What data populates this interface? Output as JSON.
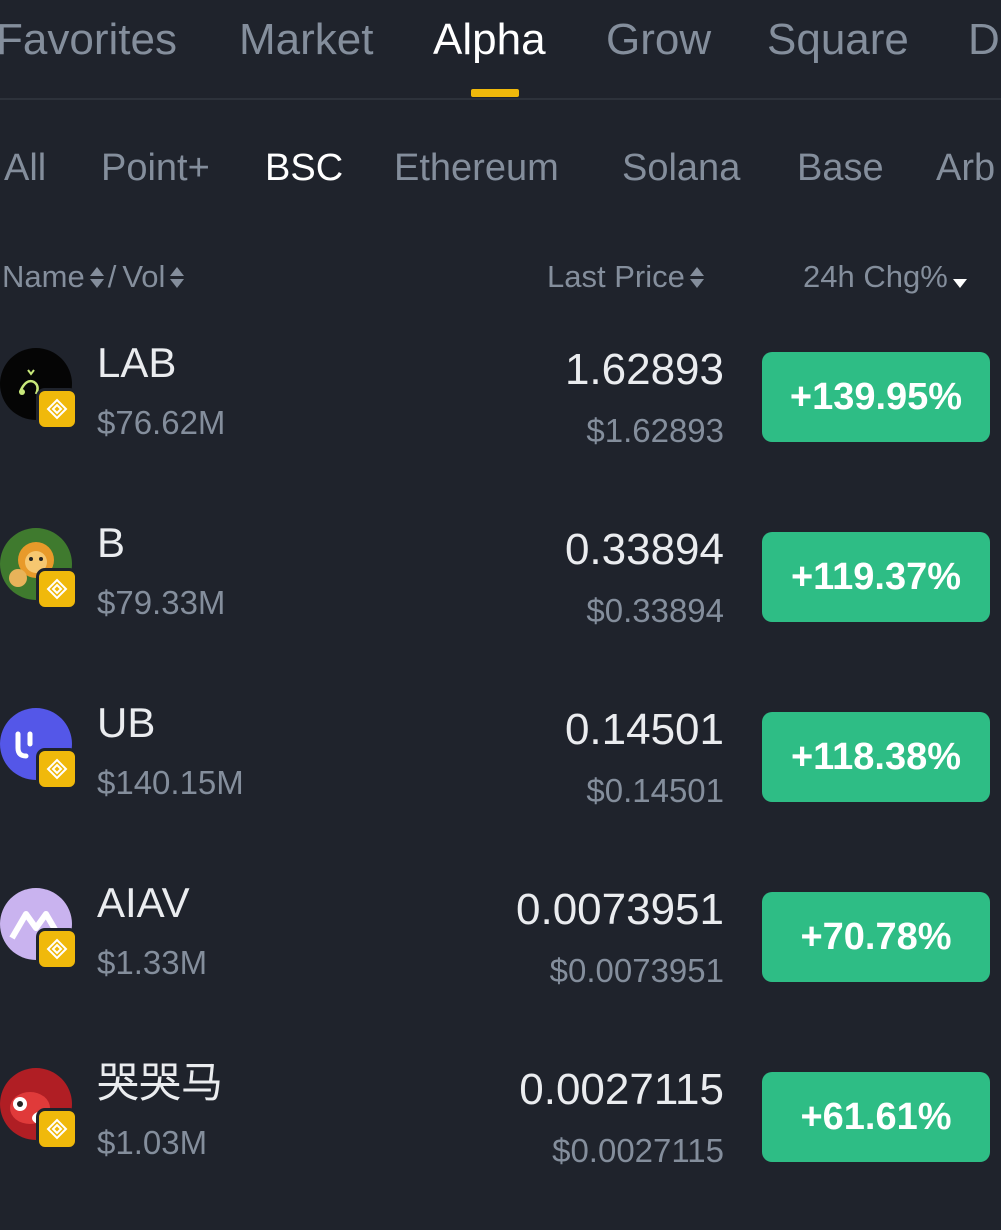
{
  "top_tabs": [
    "Favorites",
    "Market",
    "Alpha",
    "Grow",
    "Square",
    "D"
  ],
  "top_tab_active": "Alpha",
  "chain_tabs": [
    "All",
    "Point+",
    "BSC",
    "Ethereum",
    "Solana",
    "Base",
    "Arb"
  ],
  "chain_tab_active": "BSC",
  "header": {
    "name": "Name",
    "separator": "/",
    "vol": "Vol",
    "last_price": "Last Price",
    "change": "24h Chg%"
  },
  "colors": {
    "background": "#1f232c",
    "positive": "#2ebd85",
    "accent": "#f0b90b",
    "muted_text": "#848e9c"
  },
  "tokens": [
    {
      "symbol": "LAB",
      "volume": "$76.62M",
      "price": "1.62893",
      "price_usd": "$1.62893",
      "change": "+139.95%",
      "icon": "lab-token-icon"
    },
    {
      "symbol": "B",
      "volume": "$79.33M",
      "price": "0.33894",
      "price_usd": "$0.33894",
      "change": "+119.37%",
      "icon": "b-token-icon"
    },
    {
      "symbol": "UB",
      "volume": "$140.15M",
      "price": "0.14501",
      "price_usd": "$0.14501",
      "change": "+118.38%",
      "icon": "ub-token-icon"
    },
    {
      "symbol": "AIAV",
      "volume": "$1.33M",
      "price": "0.0073951",
      "price_usd": "$0.0073951",
      "change": "+70.78%",
      "icon": "aiav-token-icon"
    },
    {
      "symbol": "哭哭马",
      "volume": "$1.03M",
      "price": "0.0027115",
      "price_usd": "$0.0027115",
      "change": "+61.61%",
      "icon": "kukuma-token-icon"
    }
  ]
}
